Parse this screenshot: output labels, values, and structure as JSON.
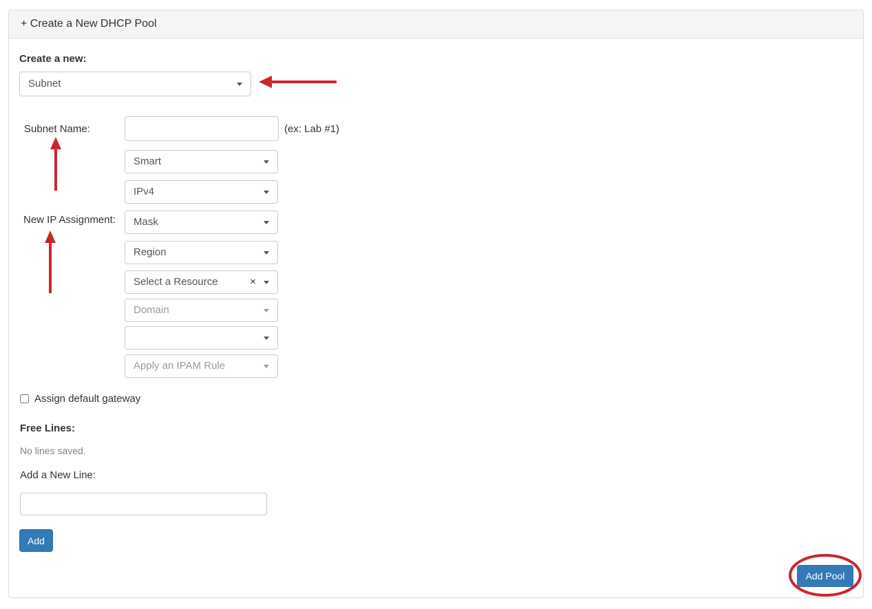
{
  "colors": {
    "primary_button": "#337ab7",
    "primary_button_border": "#2e6da4",
    "annotation_red": "#c9262b",
    "panel_border": "#dddddd",
    "panel_heading_bg": "#f5f5f5"
  },
  "icons": {
    "clear": "×"
  },
  "panel": {
    "title": "+ Create a New DHCP Pool",
    "create_new": {
      "label": "Create a new:",
      "selected": "Subnet"
    },
    "subnet_form": {
      "name_label": "Subnet Name:",
      "name_value": "",
      "name_hint": "(ex: Lab #1)",
      "ip_assignment_label": "New IP Assignment:",
      "dropdowns": [
        {
          "value": "Smart"
        },
        {
          "value": "IPv4"
        },
        {
          "value": "Mask"
        },
        {
          "value": "Region"
        },
        {
          "value": "Select a Resource"
        },
        {
          "value": "Domain"
        },
        {
          "value": ""
        },
        {
          "value": "Apply an IPAM Rule"
        }
      ],
      "gateway_checkbox": {
        "label": "Assign default gateway",
        "checked": false
      }
    },
    "free_lines": {
      "heading": "Free Lines:",
      "empty_text": "No lines saved.",
      "add_line_label": "Add a New Line:",
      "add_line_value": "",
      "add_button_label": "Add"
    },
    "add_pool_button_label": "Add Pool"
  }
}
